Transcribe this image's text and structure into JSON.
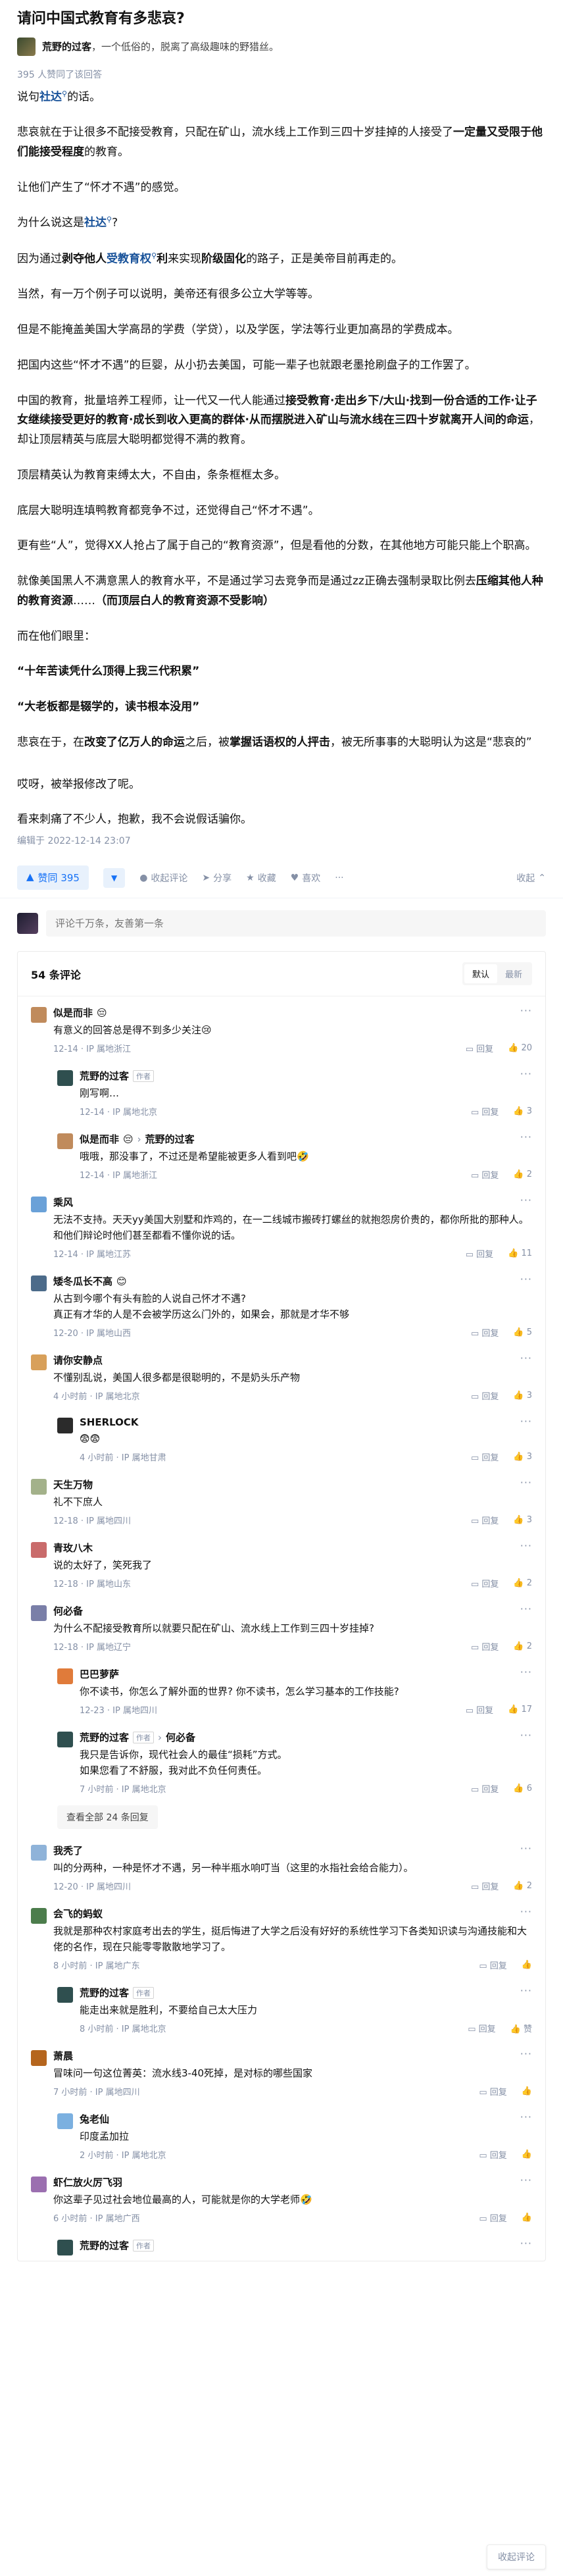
{
  "question": {
    "title": "请问中国式教育有多悲哀?"
  },
  "author": {
    "name": "荒野的过客",
    "bio": "，一个低俗的，脱离了高级趣味的野猎丝。"
  },
  "answer": {
    "likes_meta": "395 人赞同了该回答",
    "p1a": "说句",
    "p1link": "社达",
    "p1b": "的话。",
    "p2a": "悲哀就在于让很多不配接受教育，只配在矿山，流水线上工作到三四十岁挂掉的人接受了",
    "p2b": "一定量又受限于他们能接受程度",
    "p2c": "的教育。",
    "p3": "让他们产生了“怀才不遇”的感觉。",
    "p4": "为什么说这是",
    "p5a": "因为通过",
    "p5b": "剥夺他人",
    "p5link": "受教育权",
    "p5c": "利",
    "p5d": "来实现",
    "p5e": "阶级固化",
    "p5f": "的路子，正是美帝目前再走的。",
    "p6": "当然，有一万个例子可以说明，美帝还有很多公立大学等等。",
    "p7": "但是不能掩盖美国大学高昂的学费（学贷），以及学医，学法等行业更加高昂的学费成本。",
    "p8": "把国内这些“怀才不遇”的巨婴，从小扔去美国，可能一辈子也就跟老墨抢刷盘子的工作罢了。",
    "p9a": "中国的教育，批量培养工程师，让一代又一代人能通过",
    "p9b": "接受教育·走出乡下/大山·找到一份合适的工作·让子女继续接受更好的教育·成长到收入更高的群体·从而摆脱进入矿山与流水线在三四十岁就离开人间的命运",
    "p9c": "，却让顶层精英与底层大聪明都觉得不满的教育。",
    "p10": "顶层精英认为教育束缚太大，不自由，条条框框太多。",
    "p11": "底层大聪明连填鸭教育都竞争不过，还觉得自己“怀才不遇”。",
    "p12": "更有些“人”，觉得XX人抢占了属于自己的“教育资源”，但是看他的分数，在其他地方可能只能上个职高。",
    "p13a": "就像美国黑人不满意黑人的教育水平，不是通过学习去竞争而是通过zz正确去强制录取比例去",
    "p13b": "压缩其他人种的教育资源",
    "p13c": "……",
    "p13d": "（而顶层白人的教育资源不受影响）",
    "p14": "而在他们眼里：",
    "q1": "“十年苦读凭什么顶得上我三代积累”",
    "q2": "“大老板都是辍学的，读书根本没用”",
    "p15a": "悲哀在于，在",
    "p15b": "改变了亿万人的命运",
    "p15c": "之后，被",
    "p15d": "掌握话语权的人",
    "p15e": "抨击",
    "p15f": "，被无所事事的大聪明认为这是“悲哀的”",
    "p16": "哎呀，被举报修改了呢。",
    "p17": "看来刺痛了不少人，抱歉，我不会说假话骗你。",
    "edited": "编辑于 2022-12-14 23:07"
  },
  "actions": {
    "upvote": "赞同 395",
    "comments": "收起评论",
    "share": "分享",
    "favorite": "收藏",
    "like": "喜欢",
    "collapse": "收起"
  },
  "comment_input": {
    "placeholder": "评论千万条，友善第一条"
  },
  "comments_header": {
    "count": "54 条评论",
    "sort_default": "默认",
    "sort_latest": "最新"
  },
  "comments": [
    {
      "name": "似是而非",
      "emoji": "😔",
      "text": "有意义的回答总是得不到多少关注",
      "text_emoji": "😢",
      "time": "12-14 · IP 属地浙江",
      "reply": "回复",
      "likes": "20"
    },
    {
      "name": "荒野的过客",
      "tag": "作者",
      "text": "刚写啊…",
      "time": "12-14 · IP 属地北京",
      "reply": "回复",
      "likes": "3"
    },
    {
      "name": "似是而非",
      "emoji": "😔",
      "to": "荒野的过客",
      "text": "哦哦，那没事了，不过还是希望能被更多人看到吧",
      "text_emoji": "🤣",
      "time": "12-14 · IP 属地浙江",
      "reply": "回复",
      "likes": "2"
    },
    {
      "name": "乘风",
      "text": "无法不支持。天天yy美国大别墅和炸鸡的，在一二线城市搬砖打螺丝的就抱怨房价贵的，都你所批的那种人。和他们辩论时他们甚至都看不懂你说的话。",
      "time": "12-14 · IP 属地江苏",
      "reply": "回复",
      "likes": "11"
    },
    {
      "name": "矮冬瓜长不高",
      "emoji": "😊",
      "text": "从古到今哪个有头有脸的人说自己怀才不遇?\n真正有才华的人是不会被学历这么门外的，如果会，那就是才华不够",
      "time": "12-20 · IP 属地山西",
      "reply": "回复",
      "likes": "5"
    },
    {
      "name": "请你安静点",
      "text": "不懂别乱说，美国人很多都是很聪明的，不是奶头乐产物",
      "time": "4 小时前 · IP 属地北京",
      "reply": "回复",
      "likes": "3"
    },
    {
      "name": "SHERLOCK",
      "text": "😨😨",
      "time": "4 小时前 · IP 属地甘肃",
      "reply": "回复",
      "likes": "3"
    },
    {
      "name": "天生万物",
      "text": "礼不下庶人",
      "time": "12-18 · IP 属地四川",
      "reply": "回复",
      "likes": "3"
    },
    {
      "name": "青玫八木",
      "text": "说的太好了，笑死我了",
      "time": "12-18 · IP 属地山东",
      "reply": "回复",
      "likes": "2"
    },
    {
      "name": "何必备",
      "text": "为什么不配接受教育所以就要只配在矿山、流水线上工作到三四十岁挂掉?",
      "time": "12-18 · IP 属地辽宁",
      "reply": "回复",
      "likes": "2"
    },
    {
      "name": "巴巴萝萨",
      "text": "你不读书，你怎么了解外面的世界? 你不读书，怎么学习基本的工作技能?",
      "time": "12-23 · IP 属地四川",
      "reply": "回复",
      "likes": "17"
    },
    {
      "name": "荒野的过客",
      "tag": "作者",
      "to": "何必备",
      "text": "我只是告诉你，现代社会人的最佳“损耗”方式。\n如果您看了不舒服，我对此不负任何责任。",
      "time": "7 小时前 · IP 属地北京",
      "reply": "回复",
      "likes": "6"
    },
    {
      "name": "我秃了",
      "text": "叫的分两种，一种是怀才不遇，另一种半瓶水响叮当（这里的水指社会给合能力）。",
      "time": "12-20 · IP 属地四川",
      "reply": "回复",
      "likes": "2"
    },
    {
      "name": "会飞的蚂蚁",
      "text": "我就是那种农村家庭考出去的学生，挺后悔进了大学之后没有好好的系统性学习下各类知识读与沟通技能和大佬的名作，现在只能零零散散地学习了。",
      "time": "8 小时前 · IP 属地广东",
      "reply": "回复",
      "likes": ""
    },
    {
      "name": "荒野的过客",
      "tag": "作者",
      "text": "能走出来就是胜利，不要给自己太大压力",
      "time": "8 小时前 · IP 属地北京",
      "reply": "回复",
      "likes": "赞"
    },
    {
      "name": "萧晨",
      "text": "冒味问一句这位菁英：流水线3-40死掉，是对标的哪些国家",
      "time": "7 小时前 · IP 属地四川",
      "reply": "回复",
      "likes": ""
    },
    {
      "name": "兔老仙",
      "text": "印度孟加拉",
      "time": "2 小时前 · IP 属地北京",
      "reply": "回复",
      "likes": ""
    },
    {
      "name": "虾仁放火厉飞羽",
      "text": "你这辈子见过社会地位最高的人，可能就是你的大学老师",
      "text_emoji": "🤣",
      "time": "6 小时前 · IP 属地广西",
      "reply": "回复",
      "likes": ""
    },
    {
      "name": "荒野的过客",
      "tag": "作者",
      "text": "",
      "time": "",
      "reply": "",
      "likes": ""
    }
  ],
  "view_all": "查看全部 24 条回复",
  "collapse_comments": "收起评论",
  "colors": {
    "accent": "#1772f6",
    "link": "#175199",
    "meta": "#8590a6"
  }
}
